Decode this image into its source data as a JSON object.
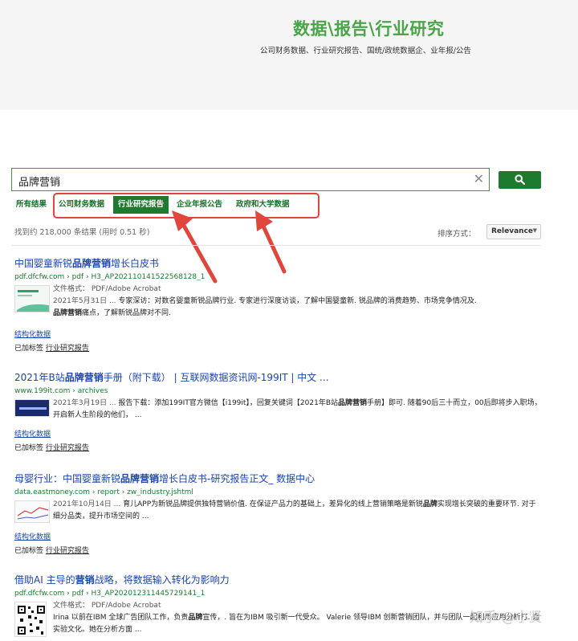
{
  "hero": {
    "title": "数据\\报告\\行业研究",
    "subtitle": "公司财务数据、行业研究报告、国统/政统数据企、业年报/公告"
  },
  "search": {
    "query": "品牌营销",
    "clear_symbol": "✕"
  },
  "tabs": [
    {
      "label": "所有结果",
      "active": false
    },
    {
      "label": "公司财务数据",
      "active": false
    },
    {
      "label": "行业研究报告",
      "active": true
    },
    {
      "label": "企业年报公告",
      "active": false
    },
    {
      "label": "政府和大学数据",
      "active": false
    }
  ],
  "stats": "找到约 218,000 条结果 (用时 0.51 秒)",
  "sort": {
    "label": "排序方式：",
    "value": "Relevance",
    "caret": "▼"
  },
  "results": [
    {
      "title_pre": "中国婴童新锐",
      "title_bold": "品牌营销",
      "title_post": "增长白皮书",
      "url": "pdf.dfcfw.com › pdf › H3_AP202110141522568128_1",
      "format": "文件格式： PDF/Adobe Acrobat",
      "date": "2021年5月31日 ... ",
      "snippet_1": "专家深访：对数名婴童新锐品牌行业. 专家进行深度访谈，了解中国婴童新. 锐品牌的消费趋势、市场竞争情况及.",
      "snippet_bold": "品牌营销",
      "snippet_2": "痛点，了解新锐品牌对不同.",
      "struct_label": "结构化数据",
      "tag_prefix": "已加标签",
      "tag": "行业研究报告"
    },
    {
      "title_pre": "2021年B站",
      "title_bold": "品牌营销",
      "title_post": "手册（附下载） | 互联网数据资讯网-199IT | 中文 ...",
      "url": "www.199it.com › archives",
      "format": "",
      "date": "2021年3月19日 ... ",
      "snippet_1": "报告下载：添加199IT官方微信【i199it】，回复关键词【2021年B站",
      "snippet_bold": "品牌营销",
      "snippet_2": "手册】即可. 随着90后三十而立，00后即将步入职场，开启新人生阶段的他们，  ...",
      "struct_label": "结构化数据",
      "tag_prefix": "已加标签",
      "tag": "行业研究报告"
    },
    {
      "title_pre": "母婴行业：中国婴童新锐",
      "title_bold": "品牌营销",
      "title_post": "增长白皮书-研究报告正文_ 数据中心",
      "url": "data.eastmoney.com › report › zw_industry.jshtml",
      "format": "",
      "date": "2021年10月14日 ... ",
      "snippet_1": "育儿APP为新锐品牌提供独特营销价值. 在保证产品力的基础上，差异化的线上营销策略是新锐",
      "snippet_bold": "品牌",
      "snippet_2": "实现增长突破的重要环节. 对于细分品类，提升市场空间的 ...",
      "struct_label": "结构化数据",
      "tag_prefix": "已加标签",
      "tag": "行业研究报告"
    },
    {
      "title_pre": "借助AI 主导的",
      "title_bold": "营销",
      "title_post": "战略，将数据输入转化为影响力",
      "url": "pdf.dfcfw.com › pdf › H3_AP202012311445729141_1",
      "format": "文件格式： PDF/Adobe Acrobat",
      "date": "",
      "snippet_1": "Irina 以前在IBM 全球广告团队工作，负责",
      "snippet_bold": "品牌",
      "snippet_2": "宣传，. 旨在为IBM 吸引新一代受众。 Valerie 领导IBM 创新营销团队，并与团队一起利用应用分析打. 造实验文化。她在分析方面 ..."
    }
  ],
  "watermark": "知乎 @小贤"
}
